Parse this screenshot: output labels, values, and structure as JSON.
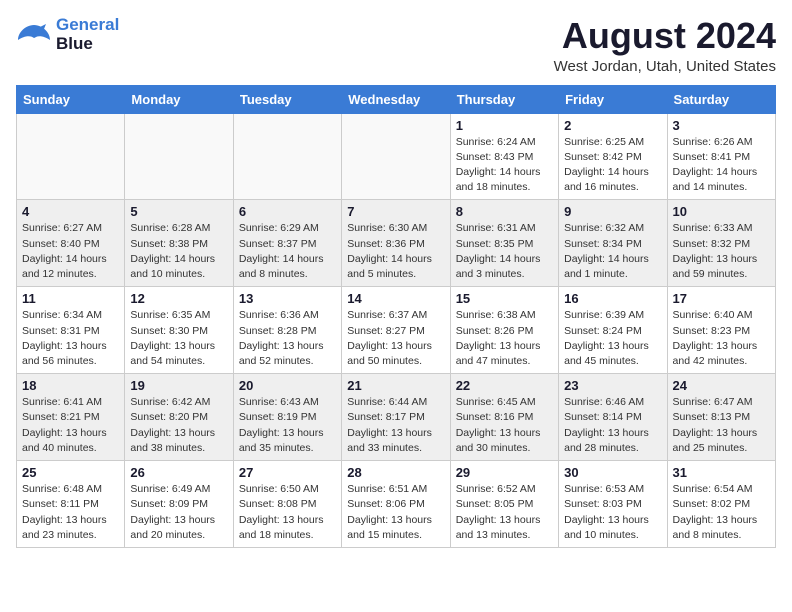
{
  "logo": {
    "line1": "General",
    "line2": "Blue"
  },
  "title": "August 2024",
  "subtitle": "West Jordan, Utah, United States",
  "weekdays": [
    "Sunday",
    "Monday",
    "Tuesday",
    "Wednesday",
    "Thursday",
    "Friday",
    "Saturday"
  ],
  "weeks": [
    [
      {
        "day": "",
        "info": ""
      },
      {
        "day": "",
        "info": ""
      },
      {
        "day": "",
        "info": ""
      },
      {
        "day": "",
        "info": ""
      },
      {
        "day": "1",
        "info": "Sunrise: 6:24 AM\nSunset: 8:43 PM\nDaylight: 14 hours\nand 18 minutes."
      },
      {
        "day": "2",
        "info": "Sunrise: 6:25 AM\nSunset: 8:42 PM\nDaylight: 14 hours\nand 16 minutes."
      },
      {
        "day": "3",
        "info": "Sunrise: 6:26 AM\nSunset: 8:41 PM\nDaylight: 14 hours\nand 14 minutes."
      }
    ],
    [
      {
        "day": "4",
        "info": "Sunrise: 6:27 AM\nSunset: 8:40 PM\nDaylight: 14 hours\nand 12 minutes."
      },
      {
        "day": "5",
        "info": "Sunrise: 6:28 AM\nSunset: 8:38 PM\nDaylight: 14 hours\nand 10 minutes."
      },
      {
        "day": "6",
        "info": "Sunrise: 6:29 AM\nSunset: 8:37 PM\nDaylight: 14 hours\nand 8 minutes."
      },
      {
        "day": "7",
        "info": "Sunrise: 6:30 AM\nSunset: 8:36 PM\nDaylight: 14 hours\nand 5 minutes."
      },
      {
        "day": "8",
        "info": "Sunrise: 6:31 AM\nSunset: 8:35 PM\nDaylight: 14 hours\nand 3 minutes."
      },
      {
        "day": "9",
        "info": "Sunrise: 6:32 AM\nSunset: 8:34 PM\nDaylight: 14 hours\nand 1 minute."
      },
      {
        "day": "10",
        "info": "Sunrise: 6:33 AM\nSunset: 8:32 PM\nDaylight: 13 hours\nand 59 minutes."
      }
    ],
    [
      {
        "day": "11",
        "info": "Sunrise: 6:34 AM\nSunset: 8:31 PM\nDaylight: 13 hours\nand 56 minutes."
      },
      {
        "day": "12",
        "info": "Sunrise: 6:35 AM\nSunset: 8:30 PM\nDaylight: 13 hours\nand 54 minutes."
      },
      {
        "day": "13",
        "info": "Sunrise: 6:36 AM\nSunset: 8:28 PM\nDaylight: 13 hours\nand 52 minutes."
      },
      {
        "day": "14",
        "info": "Sunrise: 6:37 AM\nSunset: 8:27 PM\nDaylight: 13 hours\nand 50 minutes."
      },
      {
        "day": "15",
        "info": "Sunrise: 6:38 AM\nSunset: 8:26 PM\nDaylight: 13 hours\nand 47 minutes."
      },
      {
        "day": "16",
        "info": "Sunrise: 6:39 AM\nSunset: 8:24 PM\nDaylight: 13 hours\nand 45 minutes."
      },
      {
        "day": "17",
        "info": "Sunrise: 6:40 AM\nSunset: 8:23 PM\nDaylight: 13 hours\nand 42 minutes."
      }
    ],
    [
      {
        "day": "18",
        "info": "Sunrise: 6:41 AM\nSunset: 8:21 PM\nDaylight: 13 hours\nand 40 minutes."
      },
      {
        "day": "19",
        "info": "Sunrise: 6:42 AM\nSunset: 8:20 PM\nDaylight: 13 hours\nand 38 minutes."
      },
      {
        "day": "20",
        "info": "Sunrise: 6:43 AM\nSunset: 8:19 PM\nDaylight: 13 hours\nand 35 minutes."
      },
      {
        "day": "21",
        "info": "Sunrise: 6:44 AM\nSunset: 8:17 PM\nDaylight: 13 hours\nand 33 minutes."
      },
      {
        "day": "22",
        "info": "Sunrise: 6:45 AM\nSunset: 8:16 PM\nDaylight: 13 hours\nand 30 minutes."
      },
      {
        "day": "23",
        "info": "Sunrise: 6:46 AM\nSunset: 8:14 PM\nDaylight: 13 hours\nand 28 minutes."
      },
      {
        "day": "24",
        "info": "Sunrise: 6:47 AM\nSunset: 8:13 PM\nDaylight: 13 hours\nand 25 minutes."
      }
    ],
    [
      {
        "day": "25",
        "info": "Sunrise: 6:48 AM\nSunset: 8:11 PM\nDaylight: 13 hours\nand 23 minutes."
      },
      {
        "day": "26",
        "info": "Sunrise: 6:49 AM\nSunset: 8:09 PM\nDaylight: 13 hours\nand 20 minutes."
      },
      {
        "day": "27",
        "info": "Sunrise: 6:50 AM\nSunset: 8:08 PM\nDaylight: 13 hours\nand 18 minutes."
      },
      {
        "day": "28",
        "info": "Sunrise: 6:51 AM\nSunset: 8:06 PM\nDaylight: 13 hours\nand 15 minutes."
      },
      {
        "day": "29",
        "info": "Sunrise: 6:52 AM\nSunset: 8:05 PM\nDaylight: 13 hours\nand 13 minutes."
      },
      {
        "day": "30",
        "info": "Sunrise: 6:53 AM\nSunset: 8:03 PM\nDaylight: 13 hours\nand 10 minutes."
      },
      {
        "day": "31",
        "info": "Sunrise: 6:54 AM\nSunset: 8:02 PM\nDaylight: 13 hours\nand 8 minutes."
      }
    ]
  ]
}
